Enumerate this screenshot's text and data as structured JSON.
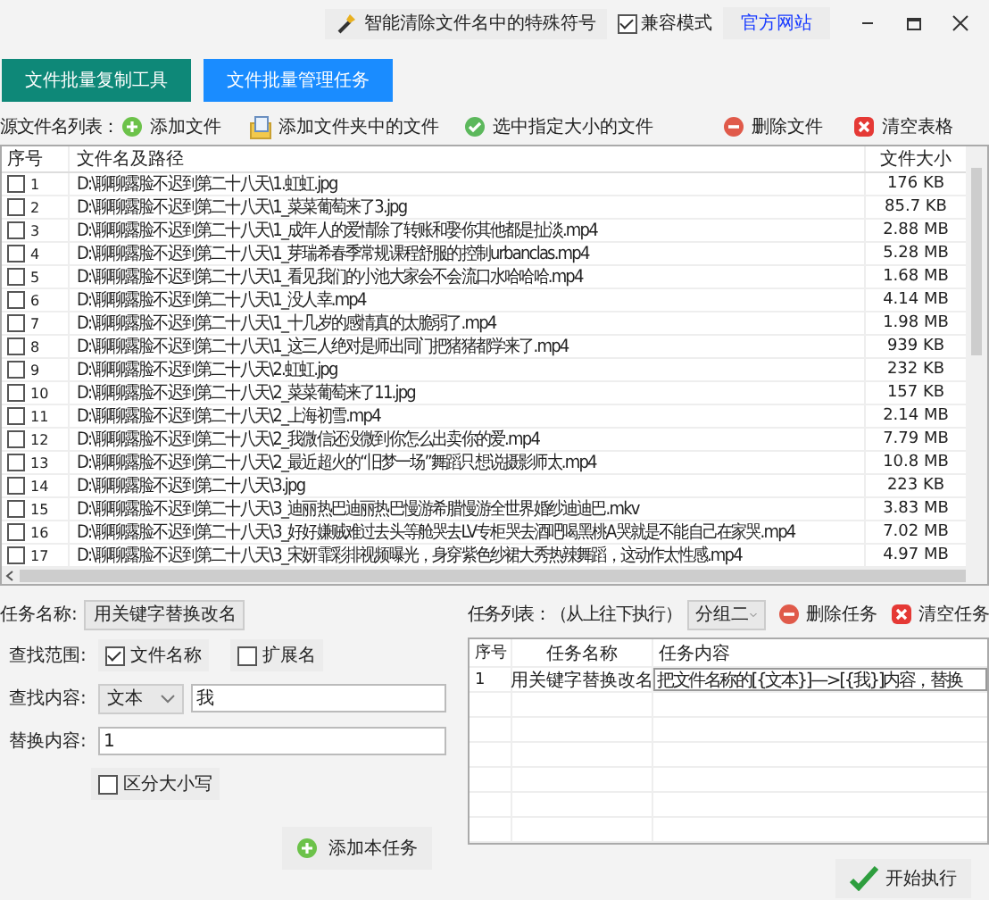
{
  "top_bar": {
    "clean_button": "智能清除文件名中的特殊符号",
    "compat_mode": {
      "label": "兼容模式",
      "checked": true
    },
    "website_link": "官方网站"
  },
  "tabs": [
    {
      "label": "文件批量复制工具",
      "selected": false
    },
    {
      "label": "文件批量管理任务",
      "selected": true
    }
  ],
  "file_toolbar": {
    "label": "源文件名列表：",
    "actions": [
      {
        "label": "添加文件",
        "kind": "add"
      },
      {
        "label": "添加文件夹中的文件",
        "kind": "folder"
      },
      {
        "label": "选中指定大小的文件",
        "kind": "check"
      },
      {
        "label": "删除文件",
        "kind": "remove"
      },
      {
        "label": "清空表格",
        "kind": "clear"
      }
    ]
  },
  "file_table": {
    "columns": [
      "序号",
      "文件名及路径",
      "文件大小"
    ],
    "rows": [
      {
        "index": "1",
        "path": "D:\\聊聊露脸不迟到第二十八天\\1.虹虹.jpg",
        "size": "176 KB",
        "checked": false
      },
      {
        "index": "2",
        "path": "D:\\聊聊露脸不迟到第二十八天\\1_菜菜葡萄来了3.jpg",
        "size": "85.7 KB",
        "checked": false
      },
      {
        "index": "3",
        "path": "D:\\聊聊露脸不迟到第二十八天\\1_成年人的爱情除了转账和娶你其他都是扯淡.mp4",
        "size": "2.88 MB",
        "checked": false
      },
      {
        "index": "4",
        "path": "D:\\聊聊露脸不迟到第二十八天\\1_芽瑞希春季常规课程舒服的控制urbanclas.mp4",
        "size": "5.28 MB",
        "checked": false
      },
      {
        "index": "5",
        "path": "D:\\聊聊露脸不迟到第二十八天\\1_看见我们的小池大家会不会流口水哈哈哈.mp4",
        "size": "1.68 MB",
        "checked": false
      },
      {
        "index": "6",
        "path": "D:\\聊聊露脸不迟到第二十八天\\1_没人幸.mp4",
        "size": "4.14 MB",
        "checked": false
      },
      {
        "index": "7",
        "path": "D:\\聊聊露脸不迟到第二十八天\\1_十几岁的感情真的太脆弱了.mp4",
        "size": "1.98 MB",
        "checked": false
      },
      {
        "index": "8",
        "path": "D:\\聊聊露脸不迟到第二十八天\\1_这三人绝对是师出同门把猪猪都学来了.mp4",
        "size": "939 KB",
        "checked": false
      },
      {
        "index": "9",
        "path": "D:\\聊聊露脸不迟到第二十八天\\2.虹虹.jpg",
        "size": "232 KB",
        "checked": false
      },
      {
        "index": "10",
        "path": "D:\\聊聊露脸不迟到第二十八天\\2_菜菜葡萄来了11.jpg",
        "size": "157 KB",
        "checked": false
      },
      {
        "index": "11",
        "path": "D:\\聊聊露脸不迟到第二十八天\\2_上海初雪.mp4",
        "size": "2.14 MB",
        "checked": false
      },
      {
        "index": "12",
        "path": "D:\\聊聊露脸不迟到第二十八天\\2_我微信还没微到你怎么出卖你的爱.mp4",
        "size": "7.79 MB",
        "checked": false
      },
      {
        "index": "13",
        "path": "D:\\聊聊露脸不迟到第二十八天\\2_最近超火的“旧梦一场”舞蹈只想说摄影师太.mp4",
        "size": "10.8 MB",
        "checked": false
      },
      {
        "index": "14",
        "path": "D:\\聊聊露脸不迟到第二十八天\\3.jpg",
        "size": "223 KB",
        "checked": false
      },
      {
        "index": "15",
        "path": "D:\\聊聊露脸不迟到第二十八天\\3_迪丽热巴迪丽热巴慢游希腊慢游全世界婚纱迪迪巴.mkv",
        "size": "3.83 MB",
        "checked": false
      },
      {
        "index": "16",
        "path": "D:\\聊聊露脸不迟到第二十八天\\3_好好嫌贼难过去头等舱哭去LV专柜哭去酒吧喝黑桃A哭就是不能自己在家哭.mp4",
        "size": "7.02 MB",
        "checked": false
      },
      {
        "index": "17",
        "path": "D:\\聊聊露脸不迟到第二十八天\\3_宋妍霏彩排视频曝光，身穿紫色纱裙大秀热辣舞蹈，这动作太性感.mp4",
        "size": "4.97 MB",
        "checked": false
      }
    ]
  },
  "task_form": {
    "name_label": "任务名称:",
    "name_value": "用关键字替换改名",
    "scope_label": "查找范围:",
    "scope_options": [
      {
        "label": "文件名称",
        "checked": true
      },
      {
        "label": "扩展名",
        "checked": false
      }
    ],
    "find_label": "查找内容:",
    "find_type": "文本",
    "find_value": "我",
    "replace_label": "替换内容:",
    "replace_value": "1",
    "case_option": {
      "label": "区分大小写",
      "checked": false
    },
    "add_button": "添加本任务"
  },
  "task_list": {
    "label": "任务列表：（从上往下执行）",
    "group": "分组二",
    "delete_button": "删除任务",
    "clear_button": "清空任务",
    "columns": [
      "序号",
      "任务名称",
      "任务内容"
    ],
    "rows": [
      {
        "index": "1",
        "name": "用关键字替换改名",
        "content": "把文件名称的[{文本}]—>[{我}]内容，替换"
      }
    ]
  },
  "start_button": "开始执行"
}
